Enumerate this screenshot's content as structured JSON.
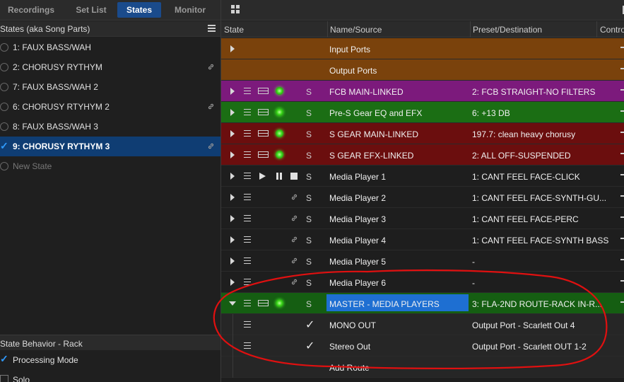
{
  "tabs": [
    {
      "label": "Recordings",
      "active": false
    },
    {
      "label": "Set List",
      "active": false
    },
    {
      "label": "States",
      "active": true
    },
    {
      "label": "Monitor",
      "active": false
    }
  ],
  "states_panel": {
    "title": "States (aka Song Parts)",
    "items": [
      {
        "label": "1: FAUX BASS/WAH",
        "linked": false,
        "selected": false
      },
      {
        "label": "2: CHORUSY RYTHYM",
        "linked": true,
        "selected": false
      },
      {
        "label": "7: FAUX BASS/WAH 2",
        "linked": false,
        "selected": false
      },
      {
        "label": "6: CHORUSY RTYHYM 2",
        "linked": true,
        "selected": false
      },
      {
        "label": "8: FAUX BASS/WAH 3",
        "linked": false,
        "selected": false
      },
      {
        "label": "9: CHORUSY RYTHYM 3",
        "linked": true,
        "selected": true
      },
      {
        "label": "New State",
        "linked": false,
        "selected": false
      }
    ]
  },
  "behavior_panel": {
    "title": "State Behavior - Rack",
    "options": [
      {
        "label": "Processing Mode",
        "checked": true
      },
      {
        "label": "Solo",
        "checked": false
      }
    ]
  },
  "columns": [
    "State",
    "Name/Source",
    "Preset/Destination",
    "Contro"
  ],
  "rows": [
    {
      "name": "Input Ports",
      "preset": "",
      "color": "#7a420c",
      "kind": "port",
      "expander": "right"
    },
    {
      "name": "Output Ports",
      "preset": "",
      "color": "#7a420c",
      "kind": "port",
      "expander": "none"
    },
    {
      "name": "FCB MAIN-LINKED",
      "preset": "2: FCB STRAIGHT-NO FILTERS",
      "color": "#7c1a7c",
      "kind": "rack",
      "expander": "right",
      "s": "S"
    },
    {
      "name": "Pre-S Gear EQ and EFX",
      "preset": "6: +13 DB",
      "color": "#1b6e14",
      "kind": "rack",
      "expander": "right",
      "s": "S"
    },
    {
      "name": "S GEAR MAIN-LINKED",
      "preset": "197.7: clean heavy chorusy",
      "color": "#6b0e0e",
      "kind": "rack",
      "expander": "right",
      "s": "S"
    },
    {
      "name": "S GEAR EFX-LINKED",
      "preset": "2: ALL OFF-SUSPENDED",
      "color": "#6b0e0e",
      "kind": "rack",
      "expander": "right",
      "s": "S"
    },
    {
      "name": "Media Player 1",
      "preset": "1: CANT FEEL FACE-CLICK",
      "color": "#1e1e1e",
      "kind": "player",
      "expander": "right",
      "s": "S"
    },
    {
      "name": "Media Player 2",
      "preset": "1: CANT FEEL FACE-SYNTH-GU...",
      "color": "#1e1e1e",
      "kind": "linked",
      "expander": "right",
      "s": "S"
    },
    {
      "name": "Media Player 3",
      "preset": "1: CANT FEEL FACE-PERC",
      "color": "#1e1e1e",
      "kind": "linked",
      "expander": "right",
      "s": "S"
    },
    {
      "name": "Media Player 4",
      "preset": "1: CANT FEEL FACE-SYNTH BASS",
      "color": "#1e1e1e",
      "kind": "linked",
      "expander": "right",
      "s": "S"
    },
    {
      "name": "Media Player 5",
      "preset": "-",
      "color": "#1e1e1e",
      "kind": "linked",
      "expander": "right",
      "s": "S"
    },
    {
      "name": "Media Player 6",
      "preset": "-",
      "color": "#1e1e1e",
      "kind": "linked",
      "expander": "right",
      "s": "S"
    },
    {
      "name": "MASTER - MEDIA PLAYERS",
      "preset": "3: FLA-2ND ROUTE-RACK IN-R...",
      "color": "#155e12",
      "kind": "rack",
      "expander": "down",
      "s": "S",
      "highlighted": true
    },
    {
      "name": "MONO OUT",
      "preset": "Output Port - Scarlett Out 4",
      "color": "#262626",
      "kind": "route",
      "expander": "none"
    },
    {
      "name": "Stereo Out",
      "preset": "Output Port - Scarlett OUT 1-2",
      "color": "#262626",
      "kind": "route",
      "expander": "none"
    },
    {
      "name": "Add Route",
      "preset": "",
      "color": "#262626",
      "kind": "add",
      "expander": "none"
    }
  ],
  "icons": {
    "grid": "grid-icon",
    "menu": "menu-icon",
    "link": "link-icon",
    "led": "led-icon"
  },
  "annotation_color": "#e01010"
}
